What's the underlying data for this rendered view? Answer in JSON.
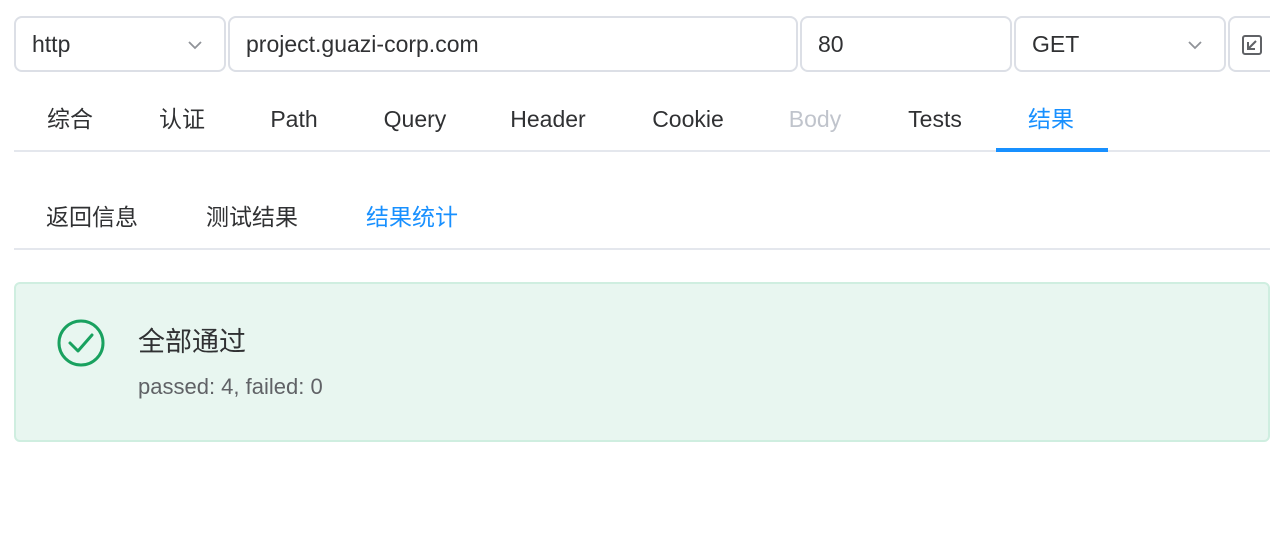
{
  "request": {
    "protocol": "http",
    "host": "project.guazi-corp.com",
    "port": "80",
    "method": "GET"
  },
  "tabs": [
    {
      "label": "综合",
      "state": "normal"
    },
    {
      "label": "认证",
      "state": "normal"
    },
    {
      "label": "Path",
      "state": "normal"
    },
    {
      "label": "Query",
      "state": "normal"
    },
    {
      "label": "Header",
      "state": "normal"
    },
    {
      "label": "Cookie",
      "state": "normal"
    },
    {
      "label": "Body",
      "state": "disabled"
    },
    {
      "label": "Tests",
      "state": "normal"
    },
    {
      "label": "结果",
      "state": "active"
    }
  ],
  "subtabs": [
    {
      "label": "返回信息",
      "state": "normal"
    },
    {
      "label": "测试结果",
      "state": "normal"
    },
    {
      "label": "结果统计",
      "state": "active"
    }
  ],
  "result": {
    "title": "全部通过",
    "description": "passed: 4, failed: 0",
    "icon": "check-circle-icon"
  },
  "colors": {
    "accent": "#1890ff",
    "success": "#19a15f",
    "success_bg": "#e8f6f0",
    "border": "#dcdfe6",
    "disabled_text": "#c0c4cc"
  }
}
